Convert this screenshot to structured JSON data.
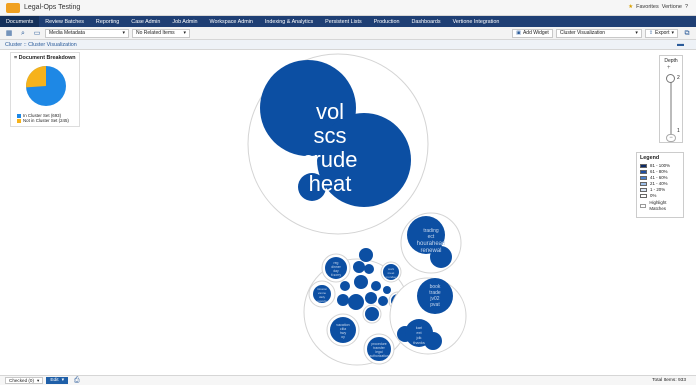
{
  "app": {
    "title": "Legal-Ops Testing"
  },
  "topright": {
    "favorites": "Favorites",
    "user": "Vertione",
    "help": "?"
  },
  "nav": {
    "tabs": [
      "Documents",
      "Review Batches",
      "Reporting",
      "Case Admin",
      "Job Admin",
      "Workspace Admin",
      "Indexing & Analytics",
      "Persistent Lists",
      "Production",
      "Dashboards",
      "Vertione Integration"
    ]
  },
  "toolbar": {
    "view_select": "Media Metadata",
    "related_select": "No Related Items",
    "add_widget": "Add Widget",
    "viz_select": "Cluster Visualization",
    "export": "Export"
  },
  "subbar": {
    "label": "Cluster :: Cluster Visualization"
  },
  "breakdown": {
    "title": "Document Breakdown",
    "in_label": "In Cluster Set (693)",
    "out_label": "Not in Cluster Set (245)",
    "in_value": 693,
    "out_value": 245,
    "in_color": "#1e88e5",
    "out_color": "#f6b21b"
  },
  "depth": {
    "title": "Depth",
    "top_value": "2",
    "bottom_value": "1",
    "current": 2
  },
  "legend": {
    "title": "Legend",
    "items": [
      {
        "label": "81 - 100%",
        "color": "#0d2a66"
      },
      {
        "label": "61 - 80%",
        "color": "#1f4ea0"
      },
      {
        "label": "41 - 60%",
        "color": "#4b7fc8"
      },
      {
        "label": "21 - 40%",
        "color": "#9fc0e8"
      },
      {
        "label": "1 - 20%",
        "color": "#d9e6f6"
      },
      {
        "label": "0%",
        "color": "#ffffff"
      }
    ],
    "highlight": "Highlight Matches"
  },
  "clusters": {
    "main_words": [
      "vol",
      "scs",
      "crude",
      "heat"
    ],
    "trading_words": [
      "trading",
      "ect",
      "hourahead",
      "renewal"
    ],
    "book_words": [
      "book",
      "trade",
      "jv02",
      "pvat"
    ],
    "small_a": [
      "reg",
      "dinner",
      "day",
      "it.sorry"
    ],
    "small_b": [
      "mission",
      "vanne",
      "daily",
      "reports"
    ],
    "small_c": [
      "work",
      "meet",
      "re",
      "monday"
    ],
    "small_d": [
      "vacation",
      "cilia",
      "hwy",
      "oy"
    ],
    "small_e": [
      "procedure",
      "transfer",
      "legal",
      "authorization"
    ],
    "small_f": [
      "kari",
      "ext",
      "jdk",
      "thanks"
    ]
  },
  "bottom": {
    "checked": "Checked (0)",
    "edit": "Edit",
    "total": "Total Items: 933"
  }
}
